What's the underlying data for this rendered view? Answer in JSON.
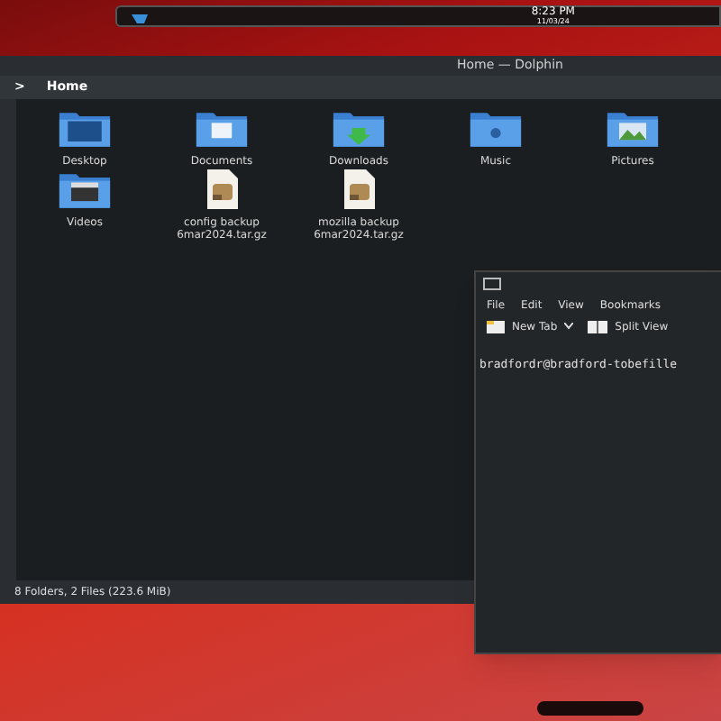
{
  "top_panel": {
    "time": "8:23 PM",
    "date": "11/03/24"
  },
  "dolphin": {
    "title": "Home — Dolphin",
    "breadcrumb": {
      "arrow": ">",
      "label": "Home"
    },
    "items": [
      {
        "kind": "desktop",
        "name": "Desktop"
      },
      {
        "kind": "documents",
        "name": "Documents"
      },
      {
        "kind": "downloads",
        "name": "Downloads"
      },
      {
        "kind": "music",
        "name": "Music"
      },
      {
        "kind": "pictures",
        "name": "Pictures"
      },
      {
        "kind": "videos",
        "name": "Videos"
      },
      {
        "kind": "archive",
        "name": "config backup 6mar2024.tar.gz"
      },
      {
        "kind": "archive",
        "name": "mozilla backup 6mar2024.tar.gz"
      }
    ],
    "status": "8 Folders, 2 Files (223.6 MiB)"
  },
  "terminal": {
    "menu": [
      "File",
      "Edit",
      "View",
      "Bookmarks"
    ],
    "toolbar": [
      {
        "kind": "newtab",
        "label": "New Tab"
      },
      {
        "kind": "split",
        "label": "Split View"
      }
    ],
    "prompt": "bradfordr@bradford-tobefille"
  }
}
